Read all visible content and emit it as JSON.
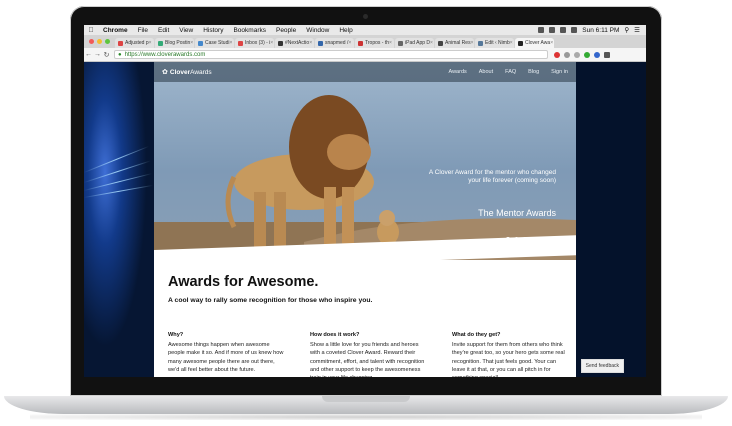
{
  "menubar": {
    "app": "Chrome",
    "items": [
      "File",
      "Edit",
      "View",
      "History",
      "Bookmarks",
      "People",
      "Window",
      "Help"
    ],
    "clock": "Sun 6:11 PM"
  },
  "tabs": [
    {
      "label": "Adjusted p"
    },
    {
      "label": "Blog Postin"
    },
    {
      "label": "Case Studi"
    },
    {
      "label": "Inbox (3) - i"
    },
    {
      "label": "#NextActio"
    },
    {
      "label": "snapmed /"
    },
    {
      "label": "Tropos - th"
    },
    {
      "label": "iPad App D"
    },
    {
      "label": "Animal Res"
    },
    {
      "label": "Edit ‹ Nimb"
    },
    {
      "label": "Clover Awa"
    }
  ],
  "address": {
    "url": "https://www.cloverawards.com"
  },
  "site": {
    "logo_bold": "Clover",
    "logo_light": "Awards",
    "nav": [
      "Awards",
      "About",
      "FAQ",
      "Blog",
      "Sign in"
    ],
    "hero_caption": "A Clover Award for the mentor who changed your life forever (coming soon)",
    "hero_title": "The Mentor Awards",
    "headline": "Awards for Awesome.",
    "subheadline": "A cool way to rally some recognition for those who inspire you.",
    "columns": [
      {
        "title": "Why?",
        "text": "Awesome things happen when awesome people make it so. And if more of us knew how many awesome people there are out there, we'd all feel better about the future."
      },
      {
        "title": "How does it work?",
        "text": "Show a little love for you friends and heroes with a coveted Clover Award. Reward their commitment, effort, and talent with recognition and other support to keep the awesomeness train in your life chugging."
      },
      {
        "title": "What do they get?",
        "text": "Invite support for them from others who think they're great too, so your hero gets some real recognition. That just feels good. Your can leave it at that, or you can all pitch in for something special!"
      }
    ],
    "feedback": "Send feedback"
  },
  "colors": {
    "accent_dot": "#e8265f",
    "url_green": "#2a7a2a"
  }
}
